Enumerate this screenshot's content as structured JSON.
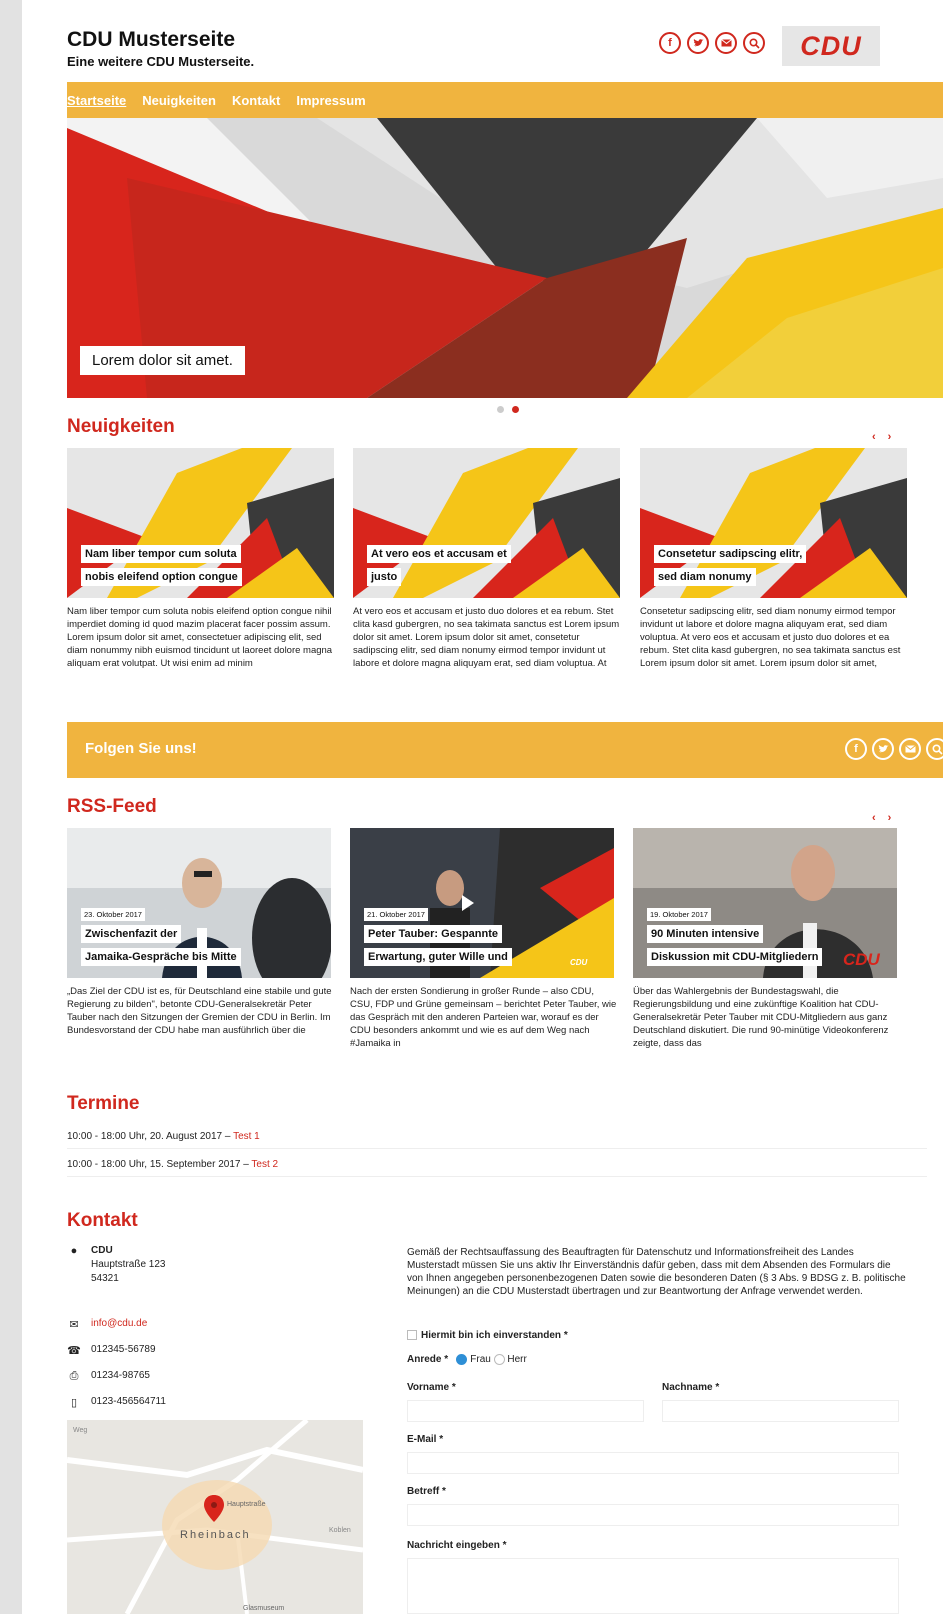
{
  "site": {
    "title": "CDU Musterseite",
    "subtitle": "Eine weitere CDU Musterseite.",
    "logo_text": "CDU"
  },
  "header_icons": [
    "facebook-icon",
    "twitter-icon",
    "mail-icon",
    "search-icon"
  ],
  "nav": [
    "Startseite",
    "Neuigkeiten",
    "Kontakt",
    "Impressum"
  ],
  "hero": {
    "caption": "Lorem dolor sit amet.",
    "slide_count": 2,
    "active_slide": 2
  },
  "news": {
    "heading": "Neuigkeiten",
    "prev": "‹",
    "next": "›",
    "items": [
      {
        "cap1": "Nam liber tempor cum soluta",
        "cap2": "nobis eleifend option congue",
        "text": "Nam liber tempor cum soluta nobis eleifend option congue nihil imperdiet doming id quod mazim placerat facer possim assum. Lorem ipsum dolor sit amet, consectetuer adipiscing elit, sed diam nonummy nibh euismod tincidunt ut laoreet dolore magna aliquam erat volutpat. Ut wisi enim ad minim"
      },
      {
        "cap1": "At vero eos et accusam et",
        "cap2": "justo",
        "text": "At vero eos et accusam et justo duo dolores et ea rebum. Stet clita kasd gubergren, no sea takimata sanctus est Lorem ipsum dolor sit amet. Lorem ipsum dolor sit amet, consetetur sadipscing elitr, sed diam nonumy eirmod tempor invidunt ut labore et dolore magna aliquyam erat, sed diam voluptua. At"
      },
      {
        "cap1": "Consetetur sadipscing elitr,",
        "cap2": "sed diam nonumy",
        "text": "Consetetur sadipscing elitr, sed diam nonumy eirmod tempor invidunt ut labore et dolore magna aliquyam erat, sed diam voluptua. At vero eos et accusam et justo duo dolores et ea rebum. Stet clita kasd gubergren, no sea takimata sanctus est Lorem ipsum dolor sit amet. Lorem ipsum dolor sit amet,"
      }
    ]
  },
  "follow": {
    "title": "Folgen Sie uns!"
  },
  "rss": {
    "heading": "RSS-Feed",
    "prev": "‹",
    "next": "›",
    "items": [
      {
        "date": "23. Oktober 2017",
        "cap1": "Zwischenfazit der",
        "cap2": "Jamaika-Gespräche bis Mitte",
        "text": "„Das Ziel der CDU ist es, für Deutschland eine stabile und gute Regierung zu bilden\", betonte CDU-Generalsekretär Peter Tauber nach den Sitzungen der Gremien der CDU in Berlin. Im Bundesvorstand der CDU habe man ausführlich über die"
      },
      {
        "date": "21. Oktober 2017",
        "cap1": "Peter Tauber: Gespannte",
        "cap2": "Erwartung, guter Wille und",
        "badge": "CDU",
        "text": "Nach der ersten Sondierung in großer Runde – also CDU, CSU, FDP und Grüne gemeinsam – berichtet Peter Tauber, wie das Gespräch mit den anderen Parteien war, worauf es der CDU besonders ankommt und wie es auf dem Weg nach #Jamaika in"
      },
      {
        "date": "19. Oktober 2017",
        "cap1": "90 Minuten intensive",
        "cap2": "Diskussion mit CDU-Mitgliedern",
        "badge": "CDU",
        "text": "Über das Wahlergebnis der Bundestagswahl, die Regierungsbildung und eine zukünftige Koalition hat CDU-Generalsekretär Peter Tauber mit CDU-Mitgliedern aus ganz Deutschland diskutiert. Die rund 90-minütige Videokonferenz zeigte, dass das"
      }
    ]
  },
  "termine": {
    "heading": "Termine",
    "items": [
      {
        "text": "10:00 - 18:00 Uhr, 20. August 2017 – ",
        "link": "Test 1"
      },
      {
        "text": "10:00 - 18:00 Uhr, 15. September 2017 – ",
        "link": "Test 2"
      }
    ]
  },
  "kontakt": {
    "heading": "Kontakt",
    "name": "CDU",
    "street": "Hauptstraße 123",
    "zip": "54321",
    "email": "info@cdu.de",
    "phone": "012345-56789",
    "fax": "01234-98765",
    "mobile": "0123-456564711"
  },
  "map": {
    "label_town": "Rheinbach",
    "label_street": "Hauptstraße",
    "label_poi": "Glasmuseum",
    "label_road": "Koblen",
    "label_weg": "Weg"
  },
  "form": {
    "notice": "Gemäß der Rechtsauffassung des Beauftragten für Datenschutz und Informationsfreiheit des Landes Musterstadt müssen Sie uns aktiv Ihr Einverständnis dafür geben, dass mit dem Absenden des Formulars die von Ihnen angegeben personenbezogenen Daten sowie die besonderen Daten (§ 3 Abs. 9 BDSG z. B. politische Meinungen) an die CDU Musterstadt übertragen und zur Beantwortung der Anfrage verwendet werden.",
    "consent": "Hiermit bin ich einverstanden *",
    "anrede": "Anrede *",
    "frau": "Frau",
    "herr": "Herr",
    "anrede_selected": "Frau",
    "vorname": "Vorname *",
    "nachname": "Nachname *",
    "email": "E-Mail *",
    "betreff": "Betreff *",
    "nachricht": "Nachricht eingeben *"
  }
}
